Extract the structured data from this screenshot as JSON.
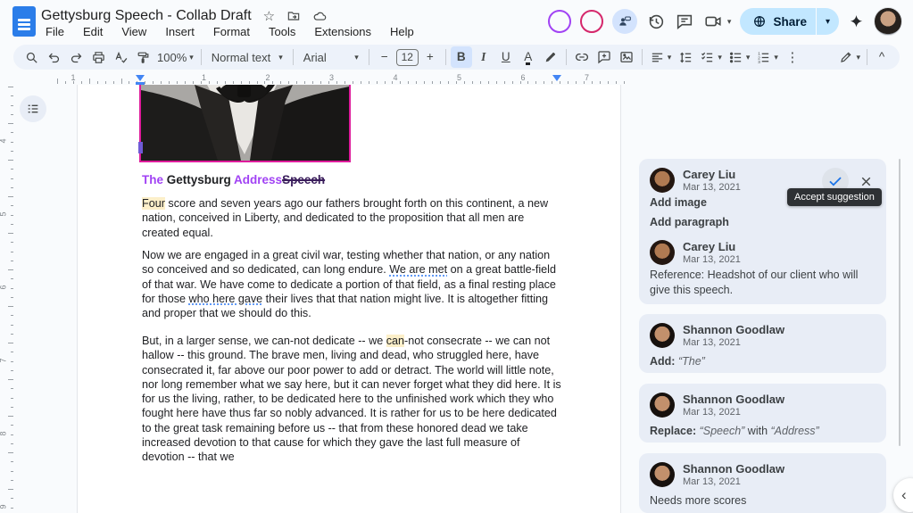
{
  "app": {
    "doc_title": "Gettysburg Speech - Collab Draft"
  },
  "menubar": {
    "items": [
      "File",
      "Edit",
      "View",
      "Insert",
      "Format",
      "Tools",
      "Extensions",
      "Help"
    ]
  },
  "header_actions": {
    "share_label": "Share"
  },
  "toolbar": {
    "zoom_value": "100%",
    "paragraph_style": "Normal text",
    "font_family": "Arial",
    "font_size": "12"
  },
  "icons": {
    "star_outline": "☆",
    "caret_down": "▾",
    "minus": "−",
    "plus": "+",
    "bold": "B",
    "italic": "I",
    "underline": "U",
    "text_color": "A",
    "more_vertical": "⋮",
    "collapse": "^",
    "panel_chevron": "‹"
  },
  "ruler": {
    "horizontal_numbers": [
      "1",
      "1",
      "2",
      "3",
      "4",
      "5",
      "6",
      "7"
    ],
    "vertical_numbers": [
      "4",
      "5",
      "6",
      "7",
      "8",
      "9"
    ]
  },
  "doc": {
    "heading": {
      "segs": [
        {
          "t": "The ",
          "c": "sug"
        },
        {
          "t": "Gettysburg ",
          "c": ""
        },
        {
          "t": "Address",
          "c": "sug"
        },
        {
          "t": "Speech",
          "c": "sugdel"
        }
      ]
    },
    "paragraphs": [
      {
        "segs": [
          {
            "t": "Four",
            "c": "hl"
          },
          {
            "t": " score and seven years ago our fathers brought forth on this continent, a new nation, conceived in Liberty, and dedicated to the proposition that all men are created equal.",
            "c": ""
          }
        ]
      },
      {
        "segs": [
          {
            "t": "Now we are engaged in a great civil war, testing whether that nation, or any nation so conceived and so dedicated, can long endure. ",
            "c": ""
          },
          {
            "t": "We are met",
            "c": "gram"
          },
          {
            "t": " on a great battle-field of that war. We have come to dedicate a portion of that field, as a final resting place for those ",
            "c": ""
          },
          {
            "t": "who here gave",
            "c": "gram"
          },
          {
            "t": " their lives that that nation might live. It is altogether fitting and proper that we should do this.",
            "c": ""
          }
        ]
      },
      {
        "segs": [
          {
            "t": "But, in a larger sense, we can-not dedicate -- we ",
            "c": ""
          },
          {
            "t": "can",
            "c": "hl"
          },
          {
            "t": "-not consecrate -- we can not hallow -- this ground. The brave men, living and dead, who struggled here, have consecrated it, far above our poor power to add or detract. The world will little note, nor long remember what we say here, but it can never forget what they did here. It is for us the living, rather, to be dedicated here to the unfinished work which they who fought here have thus far so nobly advanced. It is rather for us to be here dedicated to the great task remaining before us -- that from these honored dead we take increased devotion to that cause for which they gave the last full measure of devotion -- that we",
            "c": ""
          }
        ]
      }
    ]
  },
  "comments": [
    {
      "author": "Carey Liu",
      "date": "Mar 13, 2021",
      "lines": [
        [
          {
            "t": "Add image",
            "c": "b"
          }
        ],
        [
          {
            "t": "Add paragraph",
            "c": "b"
          }
        ]
      ],
      "tooltip": "Accept suggestion",
      "reply": {
        "author": "Carey Liu",
        "date": "Mar 13, 2021",
        "text": "Reference: Headshot of our client who will give this speech."
      }
    },
    {
      "author": "Shannon Goodlaw",
      "date": "Mar 13, 2021",
      "lines": [
        [
          {
            "t": "Add: ",
            "c": "b"
          },
          {
            "t": "“The”",
            "c": "q"
          }
        ]
      ]
    },
    {
      "author": "Shannon Goodlaw",
      "date": "Mar 13, 2021",
      "lines": [
        [
          {
            "t": "Replace: ",
            "c": "b"
          },
          {
            "t": "“Speech”",
            "c": "q"
          },
          {
            "t": " with ",
            "c": ""
          },
          {
            "t": "“Address”",
            "c": "q"
          }
        ]
      ]
    },
    {
      "author": "Shannon Goodlaw",
      "date": "Mar 13, 2021",
      "lines": [
        [
          {
            "t": "Needs more scores",
            "c": ""
          }
        ]
      ]
    }
  ],
  "colors": {
    "accent_blue": "#0b57d0",
    "suggestion_purple": "#a142f4",
    "deletion_purple": "#3b1e5c",
    "highlight_yellow": "#fcefc9",
    "share_pill_blue": "#c2e7ff",
    "comment_card": "#e8edf6",
    "image_border_magenta": "#de1b9b",
    "active_control_blue": "#d3e3fd"
  }
}
